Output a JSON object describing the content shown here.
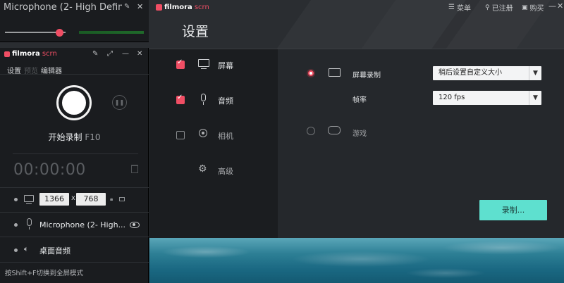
{
  "mic_window": {
    "title": "Microphone (2- High Defini",
    "volume_level": 0.89,
    "pin_icon": "pin-icon",
    "close_icon": "close-icon"
  },
  "recorder": {
    "brand_name": "filmora",
    "brand_suffix": "scrn",
    "menu": {
      "settings": "设置",
      "preview": "预览",
      "editor": "编辑器"
    },
    "start_label": "开始录制",
    "start_shortcut": "F10",
    "timer": "00:00:00",
    "width": "1366",
    "height": "768",
    "times_sign": "x",
    "microphone_label": "Microphone (2- High...",
    "desktop_audio_label": "桌面音频",
    "hint": "按Shift+F切换到全屏模式"
  },
  "main": {
    "brand_name": "filmora",
    "brand_suffix": "scrn",
    "title": "设置",
    "top_menu": {
      "menu": "菜单",
      "register": "已注册",
      "buy": "购买"
    },
    "nav": [
      {
        "label": "屏幕",
        "checked": true,
        "icon": "monitor-icon"
      },
      {
        "label": "音频",
        "checked": true,
        "icon": "microphone-icon"
      },
      {
        "label": "相机",
        "checked": false,
        "icon": "webcam-icon"
      },
      {
        "label": "高级",
        "icon": "gear-icon"
      }
    ],
    "screen_record_label": "屏幕录制",
    "screen_record_option": "稍后设置自定义大小",
    "frame_rate_label": "帧率",
    "frame_rate_option": "120 fps",
    "game_label": "游戏",
    "record_button": "录制..."
  },
  "colors": {
    "accent": "#f04e64",
    "record_button": "#5ee0cf"
  }
}
